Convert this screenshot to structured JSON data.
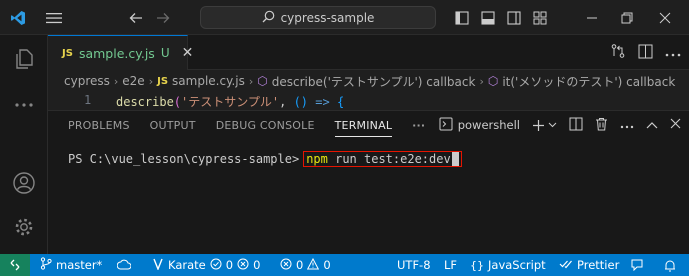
{
  "titlebar": {
    "search_text": "cypress-sample"
  },
  "tab": {
    "js_badge": "JS",
    "filename": "sample.cy.js",
    "status": "U"
  },
  "breadcrumb": {
    "items": [
      "cypress",
      "e2e",
      "sample.cy.js",
      "describe('テストサンプル') callback",
      "it('メソッドのテスト') callback"
    ],
    "js_badge": "JS"
  },
  "code": {
    "line_number": "1",
    "text": "describe('テストサンプル', () => {"
  },
  "panel": {
    "tabs": [
      "PROBLEMS",
      "OUTPUT",
      "DEBUG CONSOLE",
      "TERMINAL"
    ],
    "active_tab": "TERMINAL",
    "more": "···",
    "shell": "powershell"
  },
  "terminal": {
    "prompt": "PS C:\\vue_lesson\\cypress-sample>",
    "command_highlight": "npm",
    "command_rest": " run test:e2e:dev"
  },
  "statusbar": {
    "branch": "master*",
    "karate": "Karate",
    "karate_counts": [
      "0",
      "0"
    ],
    "errors": "0",
    "warnings": "0",
    "encoding": "UTF-8",
    "eol": "LF",
    "language": "JavaScript",
    "formatter": "Prettier"
  },
  "colors": {
    "accent": "#007acc",
    "highlight_border": "#e51400",
    "untracked_green": "#73c991",
    "terminal_yellow": "#e5e510"
  }
}
